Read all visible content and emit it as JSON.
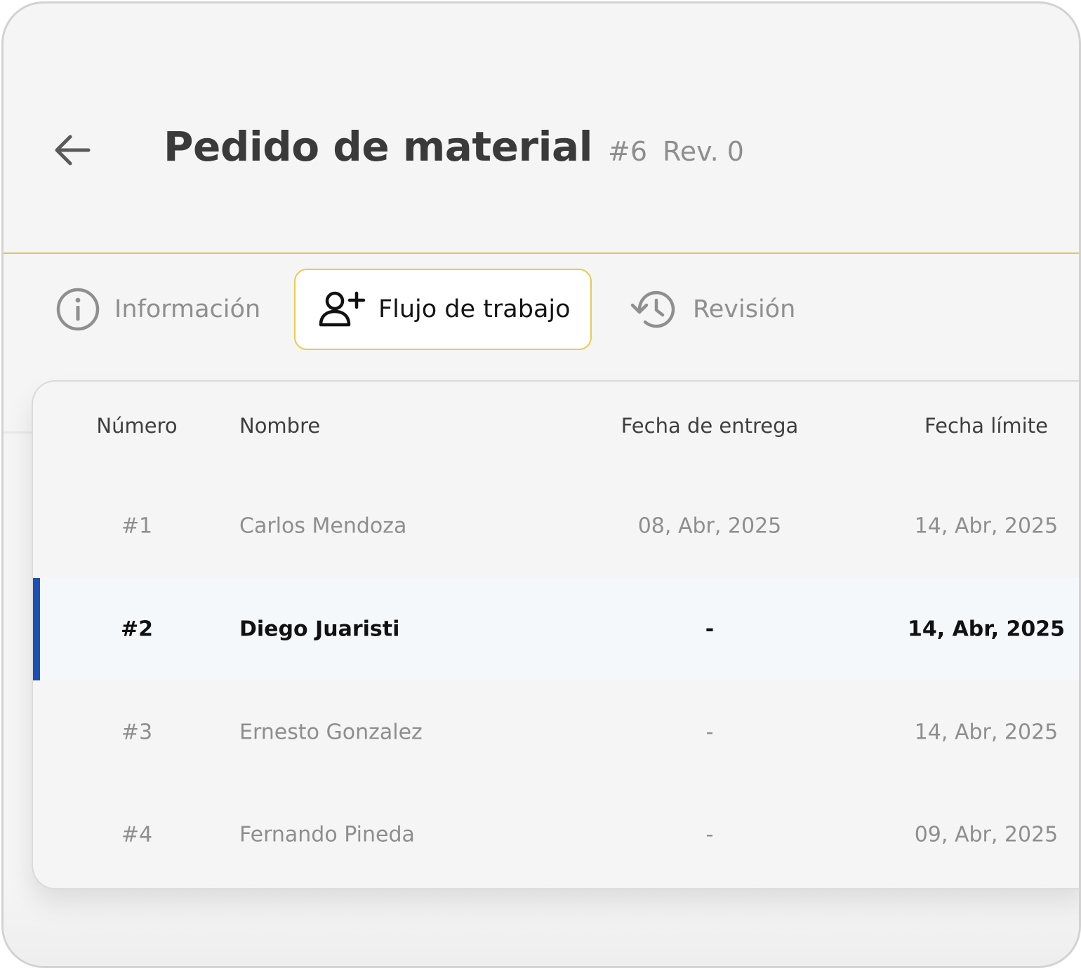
{
  "header": {
    "title": "Pedido de material",
    "number": "#6",
    "revision": "Rev. 0",
    "back_icon": "arrow-left-icon"
  },
  "tabs": [
    {
      "label": "Información",
      "icon": "info-circle-icon",
      "active": false
    },
    {
      "label": "Flujo de trabajo",
      "icon": "person-add-icon",
      "active": true
    },
    {
      "label": "Revisión",
      "icon": "history-icon",
      "active": false
    }
  ],
  "table": {
    "columns": [
      "Número",
      "Nombre",
      "Fecha de entrega",
      "Fecha límite"
    ],
    "rows": [
      {
        "number": "#1",
        "name": "Carlos Mendoza",
        "delivery": "08, Abr, 2025",
        "limit": "14, Abr, 2025",
        "selected": false
      },
      {
        "number": "#2",
        "name": "Diego Juaristi",
        "delivery": "-",
        "limit": "14, Abr, 2025",
        "selected": true
      },
      {
        "number": "#3",
        "name": "Ernesto Gonzalez",
        "delivery": "-",
        "limit": "14, Abr, 2025",
        "selected": false
      },
      {
        "number": "#4",
        "name": "Fernando Pineda",
        "delivery": "-",
        "limit": "09, Abr, 2025",
        "selected": false
      }
    ]
  },
  "colors": {
    "accent": "#ecc850",
    "selected_marker": "#1c4fb5",
    "background": "#f5f5f5"
  }
}
